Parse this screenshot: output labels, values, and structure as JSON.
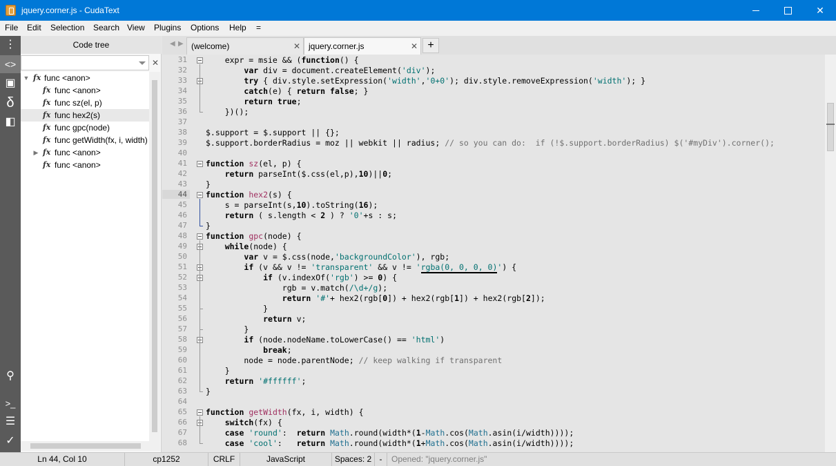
{
  "window": {
    "title": "jquery.corner.js - CudaText"
  },
  "menu": [
    {
      "label": "File"
    },
    {
      "label": "Edit"
    },
    {
      "label": "Selection"
    },
    {
      "label": "Search"
    },
    {
      "label": "View"
    },
    {
      "label": "Plugins"
    },
    {
      "label": "Options"
    },
    {
      "label": "Help"
    },
    {
      "label": "="
    }
  ],
  "sidebar": {
    "panel_title": "Code tree",
    "tree": [
      {
        "label": "func <anon>",
        "level": 0,
        "expander": "▼"
      },
      {
        "label": "func <anon>",
        "level": 1,
        "expander": ""
      },
      {
        "label": "func sz(el, p)",
        "level": 1,
        "expander": ""
      },
      {
        "label": "func hex2(s)",
        "level": 1,
        "expander": "",
        "selected": true
      },
      {
        "label": "func gpc(node)",
        "level": 1,
        "expander": ""
      },
      {
        "label": "func getWidth(fx, i, width)",
        "level": 1,
        "expander": ""
      },
      {
        "label": "func <anon>",
        "level": 1,
        "expander": "▶"
      },
      {
        "label": "func <anon>",
        "level": 1,
        "expander": ""
      }
    ]
  },
  "tabs": [
    {
      "label": "(welcome)",
      "close": "✕"
    },
    {
      "label": "jquery.corner.js",
      "close": "✕"
    }
  ],
  "tab_add_label": "+",
  "editor": {
    "current_line": 44,
    "line_numbers": [
      "31",
      "32",
      "33",
      "34",
      "35",
      "36",
      "37",
      "38",
      "39",
      "40",
      "41",
      "42",
      "43",
      "44",
      "45",
      "46",
      "47",
      "48",
      "49",
      "50",
      "51",
      "52",
      "53",
      "54",
      "55",
      "56",
      "57",
      "58",
      "59",
      "60",
      "61",
      "62",
      "63",
      "64",
      "65",
      "66",
      "67",
      "68"
    ]
  },
  "statusbar": {
    "position": "Ln 44, Col 10",
    "encoding": "cp1252",
    "line_ending": "CRLF",
    "lexer": "JavaScript",
    "indent": "Spaces: 2",
    "dash": "-",
    "message": "Opened: \"jquery.corner.js\""
  }
}
